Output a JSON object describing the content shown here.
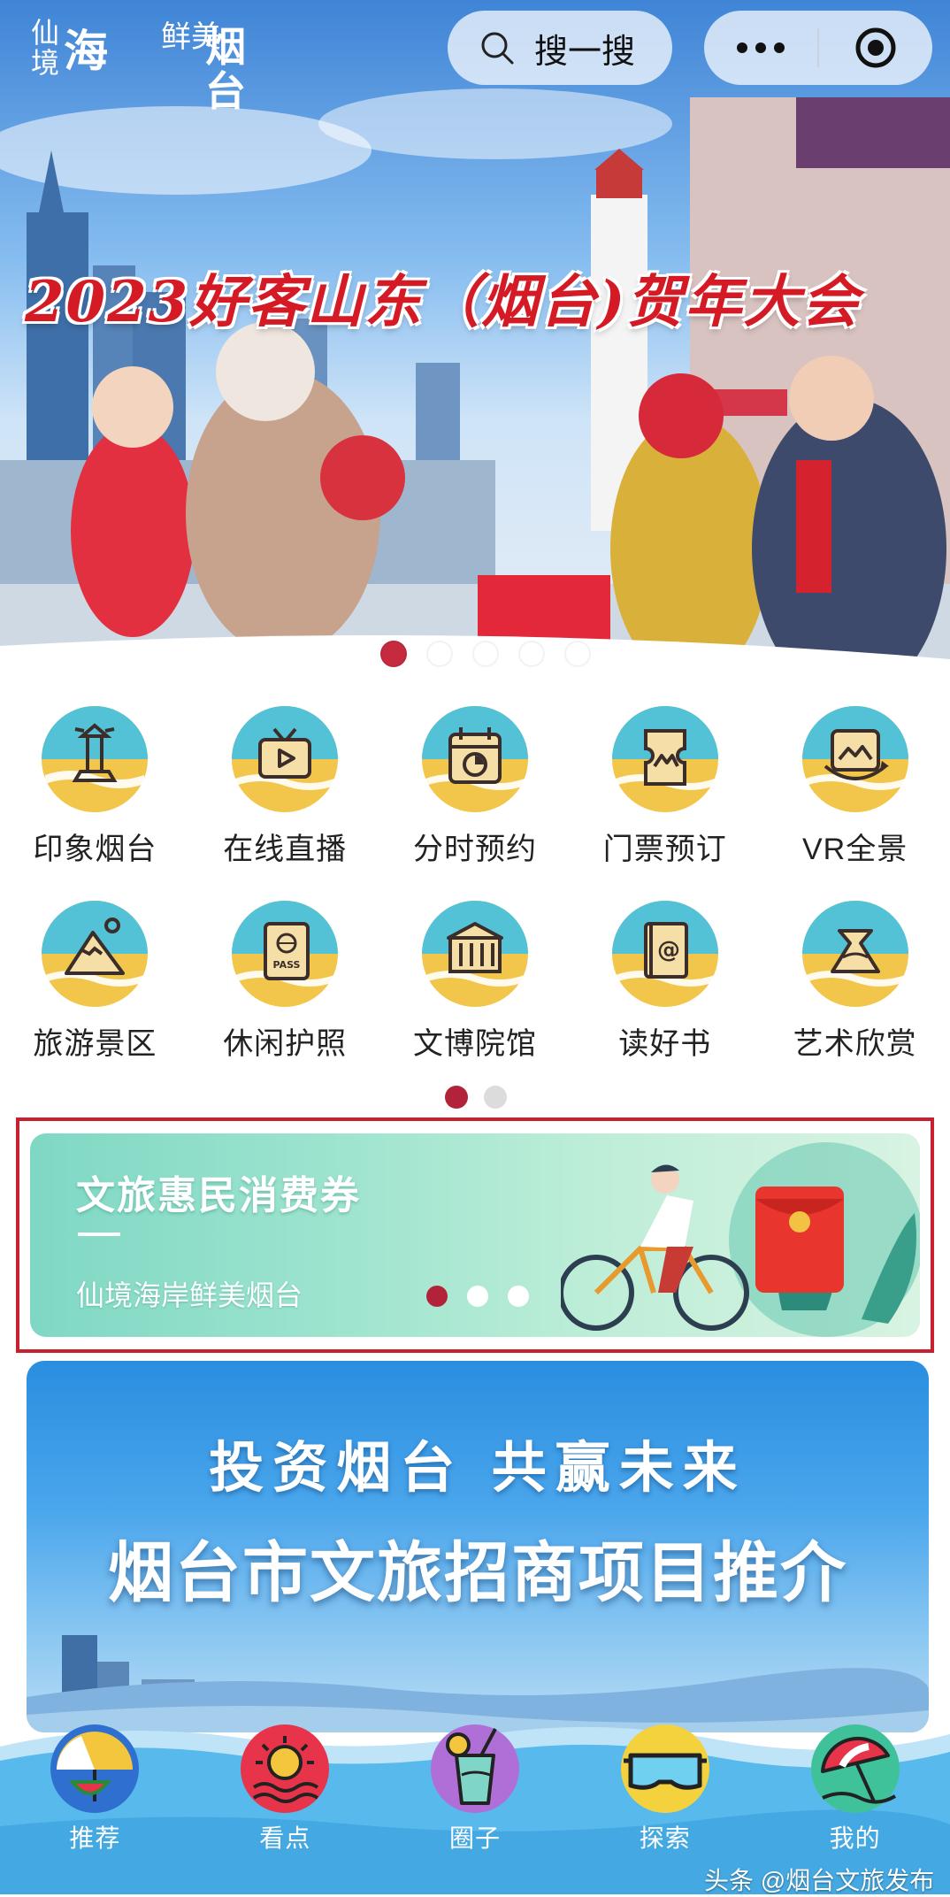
{
  "header": {
    "logo_text": [
      "仙境",
      "海",
      "鲜美",
      "烟台"
    ],
    "search_label": "搜一搜"
  },
  "hero": {
    "title": "2023好客山东（烟台)贺年大会",
    "slide_count": 5,
    "active_slide": 1
  },
  "grid": {
    "rows": [
      [
        {
          "label": "印象烟台",
          "icon": "lighthouse-icon"
        },
        {
          "label": "在线直播",
          "icon": "tv-play-icon"
        },
        {
          "label": "分时预约",
          "icon": "calendar-clock-icon"
        },
        {
          "label": "门票预订",
          "icon": "ticket-icon"
        },
        {
          "label": "VR全景",
          "icon": "vr-panorama-icon"
        }
      ],
      [
        {
          "label": "旅游景区",
          "icon": "mountain-icon"
        },
        {
          "label": "休闲护照",
          "icon": "passport-icon"
        },
        {
          "label": "文博院馆",
          "icon": "museum-icon"
        },
        {
          "label": "读好书",
          "icon": "book-icon"
        },
        {
          "label": "艺术欣赏",
          "icon": "art-icon"
        }
      ]
    ],
    "page_count": 2,
    "active_page": 1
  },
  "coupon": {
    "title": "文旅惠民消费券",
    "subtitle": "仙境海岸鲜美烟台",
    "slide_count": 3,
    "active_slide": 1
  },
  "invest": {
    "line1": "投资烟台 共赢未来",
    "line2": "烟台市文旅招商项目推介"
  },
  "tabbar": {
    "tabs": [
      {
        "label": "推荐",
        "icon": "umbrella-watermelon-icon"
      },
      {
        "label": "看点",
        "icon": "sun-waves-icon"
      },
      {
        "label": "圈子",
        "icon": "drink-icon"
      },
      {
        "label": "探索",
        "icon": "diving-mask-icon"
      },
      {
        "label": "我的",
        "icon": "beach-umbrella-icon"
      }
    ]
  },
  "watermark": "头条 @烟台文旅发布",
  "colors": {
    "accent_red": "#b2233a",
    "icon_teal": "#54c2d6",
    "icon_yellow": "#f2c64a",
    "frame_red": "#c8202f"
  }
}
